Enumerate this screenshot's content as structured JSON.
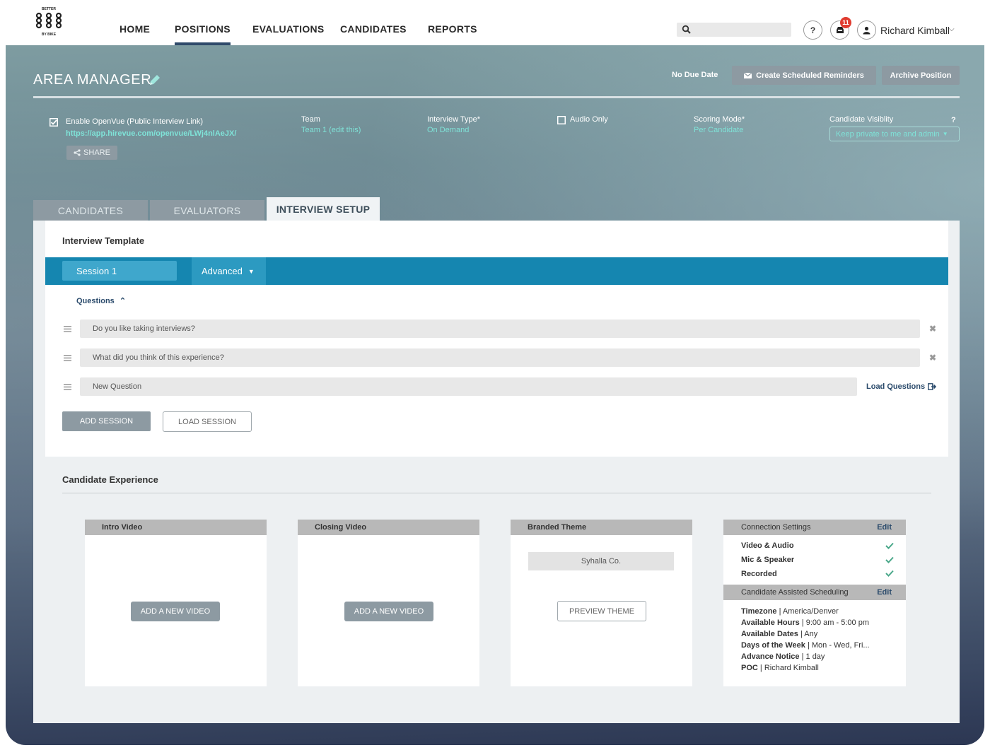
{
  "logo_text": {
    "top": "BETTER",
    "bottom": "BY BIKE"
  },
  "nav": {
    "items": [
      {
        "label": "HOME"
      },
      {
        "label": "POSITIONS"
      },
      {
        "label": "EVALUATIONS"
      },
      {
        "label": "CANDIDATES"
      },
      {
        "label": "REPORTS"
      }
    ],
    "active": "POSITIONS"
  },
  "header": {
    "help_label": "?",
    "notification_count": "11",
    "user_name": "Richard Kimball"
  },
  "position": {
    "title": "AREA MANAGER",
    "due_date": "No Due Date",
    "create_reminders_label": "Create Scheduled Reminders",
    "archive_label": "Archive Position"
  },
  "settings": {
    "openvue_label": "Enable OpenVue (Public Interview Link)",
    "openvue_url": "https://app.hirevue.com/openvue/LWj4nlAeJX/",
    "openvue_enabled": true,
    "share_label": "SHARE",
    "team_label": "Team",
    "team_value": "Team 1 (edit this)",
    "interview_type_label": "Interview Type*",
    "interview_type_value": "On Demand",
    "audio_only_label": "Audio Only",
    "audio_only_checked": false,
    "scoring_mode_label": "Scoring Mode*",
    "scoring_mode_value": "Per Candidate",
    "visibility_label": "Candidate Visiblity",
    "visibility_help": "?",
    "visibility_value": "Keep private to me and admin"
  },
  "tabs": [
    {
      "label": "CANDIDATES",
      "active": false
    },
    {
      "label": "EVALUATORS",
      "active": false
    },
    {
      "label": "INTERVIEW SETUP",
      "active": true
    }
  ],
  "interview_template": {
    "title": "Interview Template",
    "session_label": "Session 1",
    "advanced_label": "Advanced",
    "questions_toggle": "Questions",
    "questions": [
      {
        "text": "Do you like taking interviews?"
      },
      {
        "text": "What did you think of this experience?"
      }
    ],
    "new_question_placeholder": "New Question",
    "load_questions_label": "Load Questions",
    "add_session_label": "ADD SESSION",
    "load_session_label": "LOAD SESSION"
  },
  "candidate_experience": {
    "title": "Candidate Experience",
    "intro_video": {
      "header": "Intro Video",
      "button": "ADD A NEW VIDEO"
    },
    "closing_video": {
      "header": "Closing Video",
      "button": "ADD A NEW VIDEO"
    },
    "branded_theme": {
      "header": "Branded Theme",
      "theme_name": "Syhalla Co.",
      "button": "PREVIEW THEME"
    },
    "connection_settings": {
      "header": "Connection Settings",
      "edit_label": "Edit",
      "items": [
        {
          "label": "Video & Audio",
          "ok": true
        },
        {
          "label": "Mic & Speaker",
          "ok": true
        },
        {
          "label": "Recorded",
          "ok": true
        }
      ]
    },
    "scheduling": {
      "header": "Candidate Assisted Scheduling",
      "edit_label": "Edit",
      "lines": [
        {
          "key": "Timezone",
          "value": "America/Denver"
        },
        {
          "key": "Available Hours",
          "value": "9:00 am - 5:00 pm"
        },
        {
          "key": "Available Dates",
          "value": "Any"
        },
        {
          "key": "Days of the Week",
          "value": "Mon - Wed, Fri..."
        },
        {
          "key": "Advance Notice",
          "value": "1 day"
        },
        {
          "key": "POC",
          "value": "Richard Kimball"
        }
      ]
    }
  },
  "colors": {
    "session_bar": "#1586b0",
    "accent_link": "#7fe3d8",
    "nav_active_underline": "#2f4a6a",
    "notification_badge": "#e03b2f",
    "check_ok": "#4aa88a"
  }
}
